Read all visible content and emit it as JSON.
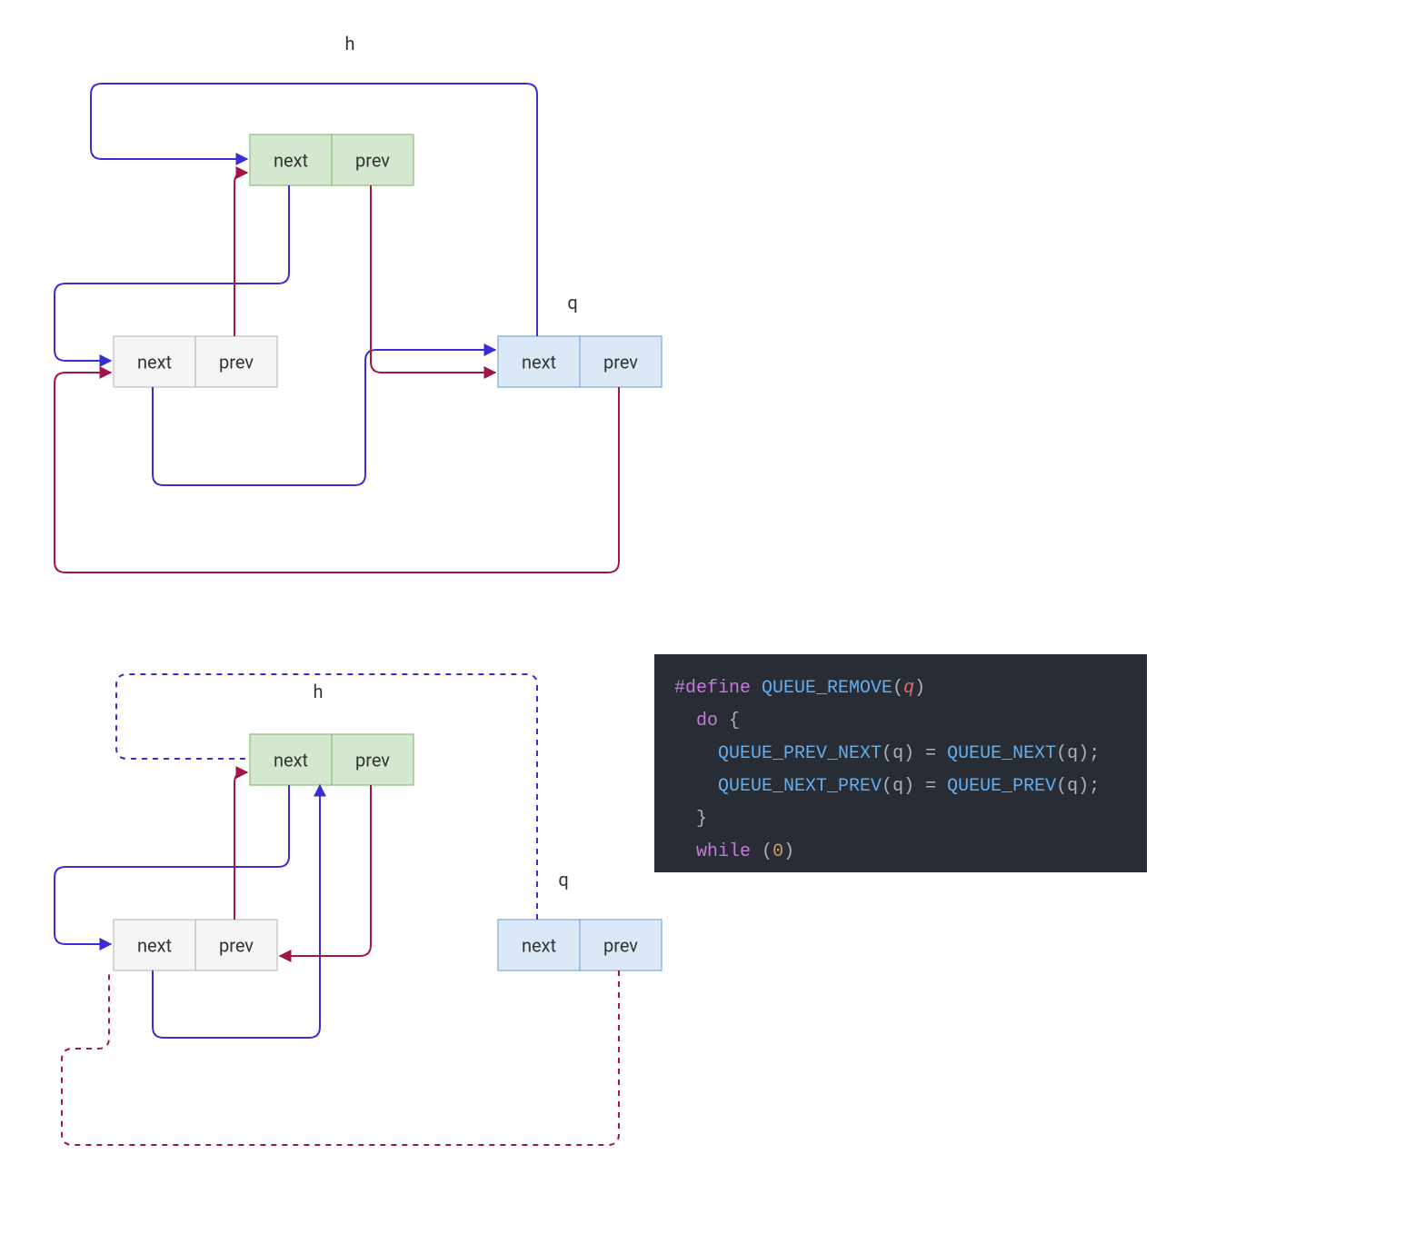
{
  "labels": {
    "next": "next",
    "prev": "prev",
    "h": "h",
    "q": "q"
  },
  "colors": {
    "edge_next": "#3b2ed0",
    "edge_prev": "#a31545",
    "node_h_fill": "#d4e8cf",
    "node_h_stroke": "#8abf78",
    "node_mid_fill": "#f5f5f5",
    "node_mid_stroke": "#bdbdbd",
    "node_q_fill": "#dbe9f7",
    "node_q_stroke": "#7fa8d6",
    "code_bg": "#282c34"
  },
  "code": {
    "define": "#define",
    "macro": "QUEUE_REMOVE",
    "param": "q",
    "do": "do",
    "brace_open": "{",
    "line1_lhs": "QUEUE_PREV_NEXT",
    "line1_rhs": "QUEUE_NEXT",
    "line2_lhs": "QUEUE_NEXT_PREV",
    "line2_rhs": "QUEUE_PREV",
    "arg": "q",
    "eq": " = ",
    "semi": ";",
    "brace_close": "}",
    "while": "while",
    "zero": "0"
  },
  "diagrams": {
    "before": {
      "title_h": "h",
      "title_q": "q",
      "nodes": {
        "h": {
          "style": "green",
          "fields": [
            "next",
            "prev"
          ]
        },
        "mid": {
          "style": "grey",
          "fields": [
            "next",
            "prev"
          ]
        },
        "q": {
          "style": "blue",
          "fields": [
            "next",
            "prev"
          ]
        }
      },
      "edges": [
        {
          "kind": "next",
          "from": "h.next",
          "to": "mid",
          "dashed": false
        },
        {
          "kind": "next",
          "from": "mid.next",
          "to": "q",
          "dashed": false
        },
        {
          "kind": "next",
          "from": "q.next",
          "to": "h",
          "dashed": false
        },
        {
          "kind": "prev",
          "from": "h.prev",
          "to": "q",
          "dashed": false
        },
        {
          "kind": "prev",
          "from": "mid.prev",
          "to": "h",
          "dashed": false
        },
        {
          "kind": "prev",
          "from": "q.prev",
          "to": "mid",
          "dashed": false
        }
      ]
    },
    "after": {
      "title_h": "h",
      "title_q": "q",
      "nodes": {
        "h": {
          "style": "green",
          "fields": [
            "next",
            "prev"
          ]
        },
        "mid": {
          "style": "grey",
          "fields": [
            "next",
            "prev"
          ]
        },
        "q": {
          "style": "blue",
          "fields": [
            "next",
            "prev"
          ]
        }
      },
      "edges": [
        {
          "kind": "next",
          "from": "h.next",
          "to": "mid",
          "dashed": false
        },
        {
          "kind": "next",
          "from": "mid.next",
          "to": "h",
          "dashed": false
        },
        {
          "kind": "next",
          "from": "q.next",
          "to": "h",
          "dashed": true
        },
        {
          "kind": "prev",
          "from": "h.prev",
          "to": "mid",
          "dashed": false
        },
        {
          "kind": "prev",
          "from": "mid.prev",
          "to": "h",
          "dashed": false
        },
        {
          "kind": "prev",
          "from": "q.prev",
          "to": "mid",
          "dashed": true
        }
      ]
    }
  }
}
